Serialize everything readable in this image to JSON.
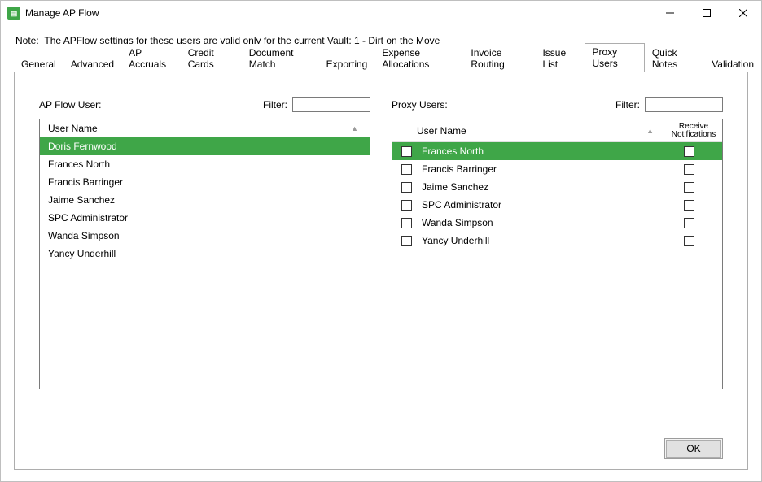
{
  "window": {
    "title": "Manage AP Flow"
  },
  "note": {
    "label": "Note:",
    "text": "The APFlow settings for these users are valid only for the current Vault: 1 - Dirt on the Move"
  },
  "tabs": [
    "General",
    "Advanced",
    "AP Accruals",
    "Credit Cards",
    "Document Match",
    "Exporting",
    "Expense Allocations",
    "Invoice Routing",
    "Issue List",
    "Proxy Users",
    "Quick Notes",
    "Validation"
  ],
  "active_tab_index": 9,
  "left_panel": {
    "title": "AP Flow User:",
    "filter_label": "Filter:",
    "filter_value": "",
    "header": "User Name",
    "selected_index": 0,
    "rows": [
      "Doris Fernwood",
      "Frances North",
      "Francis Barringer",
      "Jaime Sanchez",
      "SPC Administrator",
      "Wanda Simpson",
      "Yancy Underhill"
    ]
  },
  "right_panel": {
    "title": "Proxy Users:",
    "filter_label": "Filter:",
    "filter_value": "",
    "header_name": "User Name",
    "header_receive_line1": "Receive",
    "header_receive_line2": "Notifications",
    "selected_index": 0,
    "rows": [
      {
        "name": "Frances North",
        "checked": false,
        "receive": false
      },
      {
        "name": "Francis Barringer",
        "checked": false,
        "receive": false
      },
      {
        "name": "Jaime Sanchez",
        "checked": false,
        "receive": false
      },
      {
        "name": "SPC Administrator",
        "checked": false,
        "receive": false
      },
      {
        "name": "Wanda Simpson",
        "checked": false,
        "receive": false
      },
      {
        "name": "Yancy Underhill",
        "checked": false,
        "receive": false
      }
    ]
  },
  "footer": {
    "ok_label": "OK"
  }
}
